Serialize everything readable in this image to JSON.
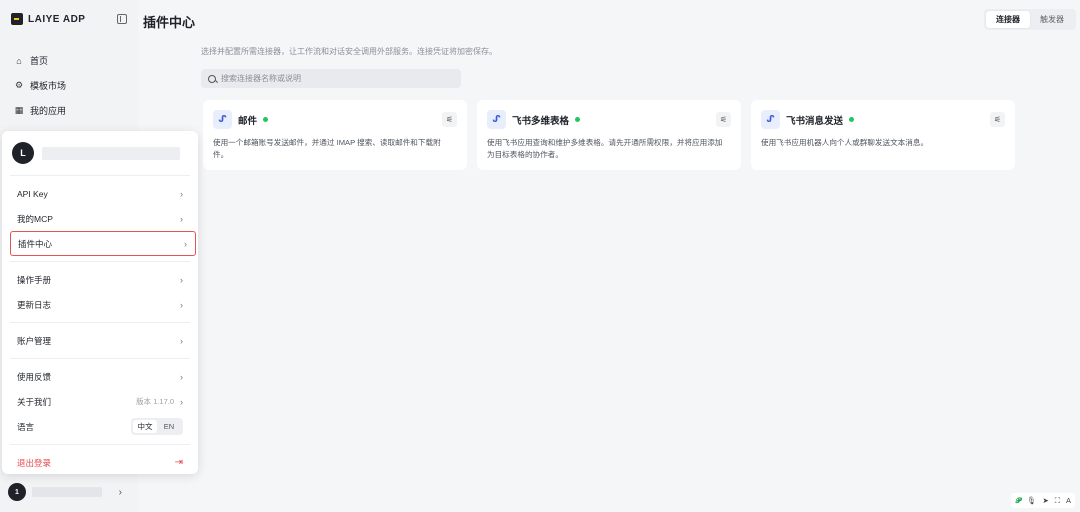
{
  "app": {
    "logo_text": "LAIYE ADP"
  },
  "sidebar": {
    "items": [
      {
        "label": "首页",
        "icon": "home-icon",
        "glyph": "⌂"
      },
      {
        "label": "模板市场",
        "icon": "template-icon",
        "glyph": "⚙"
      },
      {
        "label": "我的应用",
        "icon": "apps-icon",
        "glyph": "▦"
      }
    ],
    "user_initial": "1"
  },
  "header": {
    "title": "插件中心",
    "tabs": [
      {
        "label": "连接器",
        "active": true
      },
      {
        "label": "触发器",
        "active": false
      }
    ]
  },
  "main": {
    "subtitle": "选择并配置所需连接器，让工作流和对话安全调用外部服务。连接凭证将加密保存。",
    "search_placeholder": "搜索连接器名称或说明",
    "cards": [
      {
        "title": "邮件",
        "status_color": "#22c55e",
        "description": "使用一个邮箱账号发送邮件，并通过 IMAP 搜索、读取邮件和下载附件。"
      },
      {
        "title": "飞书多维表格",
        "status_color": "#22c55e",
        "description": "使用飞书应用查询和维护多维表格。请先开通所需权限，并将应用添加为目标表格的协作者。"
      },
      {
        "title": "飞书消息发送",
        "status_color": "#22c55e",
        "description": "使用飞书应用机器人向个人或群聊发送文本消息。"
      }
    ]
  },
  "popover": {
    "user_initial": "L",
    "items_group1": [
      {
        "label": "API Key"
      },
      {
        "label": "我的MCP"
      },
      {
        "label": "插件中心",
        "highlight": true
      }
    ],
    "items_group2": [
      {
        "label": "操作手册"
      },
      {
        "label": "更新日志"
      }
    ],
    "items_group3": [
      {
        "label": "账户管理"
      }
    ],
    "feedback": "使用反馈",
    "about": "关于我们",
    "version": "版本 1.17.0",
    "language_label": "语言",
    "lang_options": [
      "中文",
      "EN"
    ],
    "logout": "退出登录"
  },
  "toolbar": {
    "items": [
      "𝓟",
      "🎙",
      "➤",
      "⛶",
      "A"
    ]
  },
  "colors": {
    "accent_red": "#e5484d",
    "highlight_border": "#e55353",
    "status_green": "#22c55e"
  }
}
